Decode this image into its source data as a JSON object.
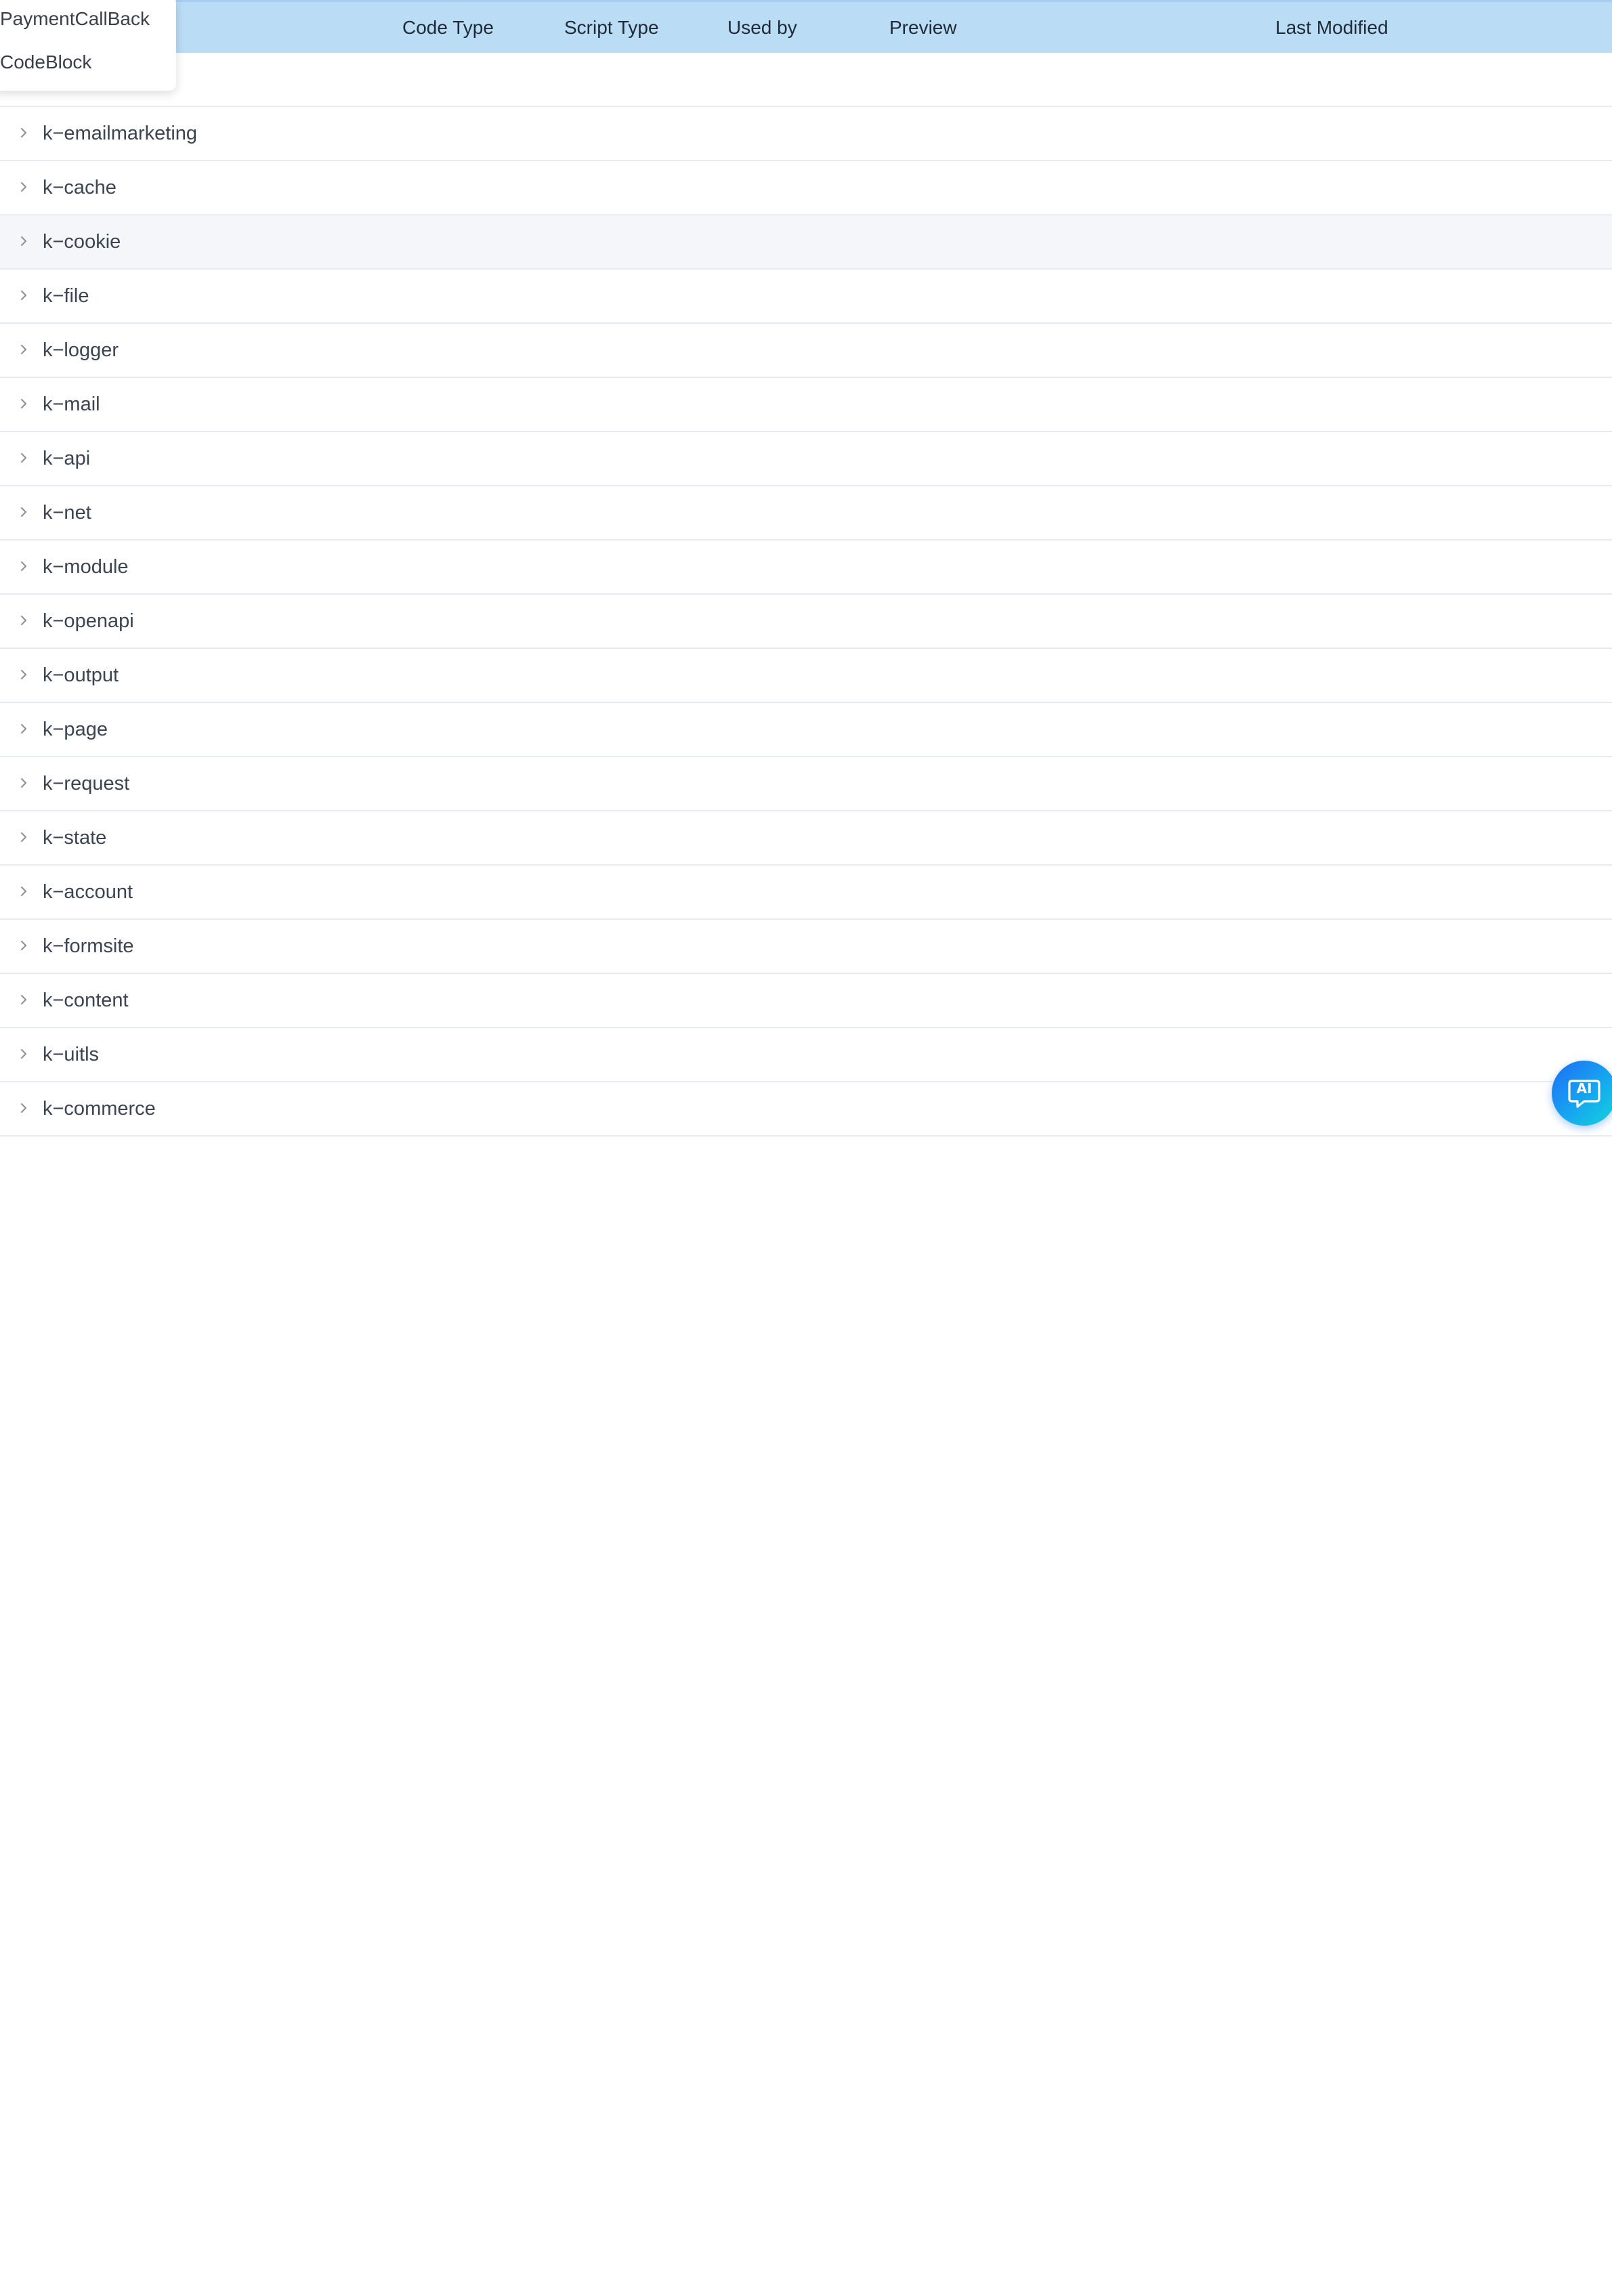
{
  "table": {
    "columns": {
      "code_type": "Code Type",
      "script_type": "Script Type",
      "used_by": "Used by",
      "preview": "Preview",
      "last_modified": "Last Modified"
    },
    "rows": [
      {
        "label": "k−emailmarketing"
      },
      {
        "label": "k−cache"
      },
      {
        "label": "k−cookie"
      },
      {
        "label": "k−file"
      },
      {
        "label": "k−logger"
      },
      {
        "label": "k−mail"
      },
      {
        "label": "k−api"
      },
      {
        "label": "k−net"
      },
      {
        "label": "k−module"
      },
      {
        "label": "k−openapi"
      },
      {
        "label": "k−output"
      },
      {
        "label": "k−page"
      },
      {
        "label": "k−request"
      },
      {
        "label": "k−state"
      },
      {
        "label": "k−account"
      },
      {
        "label": "k−formsite"
      },
      {
        "label": "k−content"
      },
      {
        "label": "k−uitls"
      },
      {
        "label": "k−commerce"
      }
    ]
  },
  "dropdown": {
    "items": [
      "PaymentCallBack",
      "CodeBlock"
    ]
  },
  "ai_button": {
    "label": "AI",
    "icon": "chat-bubble-icon",
    "colors": [
      "#1e6cf5",
      "#13d6d8"
    ]
  },
  "colors": {
    "header_bg": "#badcf5",
    "row_hover_bg": "#f5f6f9",
    "divider": "#e8ebf0"
  }
}
